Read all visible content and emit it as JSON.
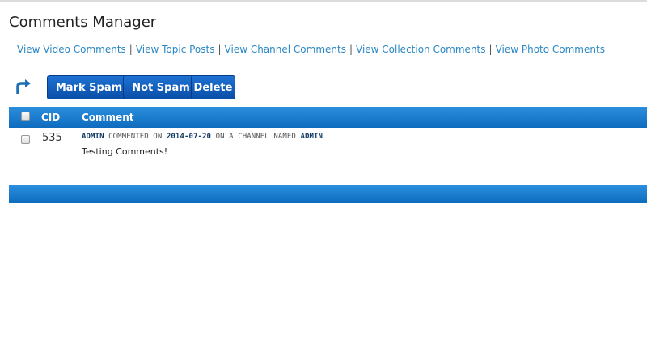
{
  "page": {
    "title": "Comments Manager"
  },
  "nav": {
    "links": [
      "View Video Comments",
      "View Topic Posts",
      "View Channel Comments",
      "View Collection Comments",
      "View Photo Comments"
    ],
    "separator": "|"
  },
  "toolbar": {
    "icon": "bulk-action-arrow-icon",
    "mark_spam": "Mark Spam",
    "not_spam": "Not Spam",
    "delete": "Delete"
  },
  "table": {
    "headers": {
      "cid": "CID",
      "comment": "Comment"
    },
    "rows": [
      {
        "cid": "535",
        "user": "ADMIN",
        "meta_1": "COMMENTED ON",
        "date": "2014-07-20",
        "meta_2": "ON A CHANNEL NAMED",
        "channel": "ADMIN",
        "text": "Testing Comments!"
      }
    ]
  },
  "colors": {
    "header_bar": "#1a7acc",
    "button": "#0a56b5",
    "link": "#2a87c4"
  }
}
